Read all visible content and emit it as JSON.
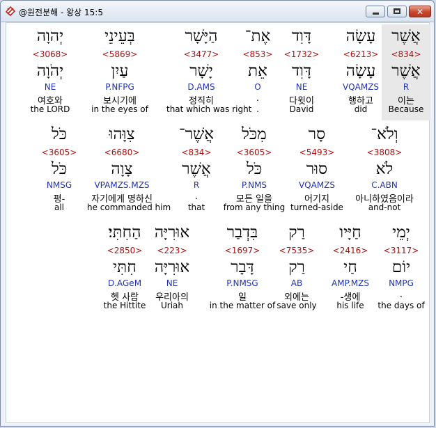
{
  "window": {
    "title": "@원전분해 - 왕상 15:5",
    "icon": "app-logo-icon",
    "controls": {
      "minimize": "minimize-icon",
      "maximize": "maximize-icon",
      "close": "close-icon"
    }
  },
  "rows": [
    {
      "words": [
        {
          "hebrew": "יְהוָה",
          "strong": "<3068>",
          "lemma": "יְהֹוָה",
          "morph": "NE",
          "korean": "여호와",
          "english": "the LORD"
        },
        {
          "hebrew": "בְּעֵינֵי",
          "strong": "<5869>",
          "lemma": "עַיִן",
          "morph": "P.NFPG",
          "korean": "보시기에",
          "english": "in the eyes of"
        },
        {
          "hebrew": "הַיָּשָׁר",
          "strong": "<3477>",
          "lemma": "יָשָׁר",
          "morph": "D.AMS",
          "korean": "정직히",
          "english": "that which was right"
        },
        {
          "hebrew": "אֶת־",
          "strong": "<853>",
          "lemma": "אֵת",
          "morph": "O",
          "korean": ".",
          "english": "."
        },
        {
          "hebrew": "דָּוִד",
          "strong": "<1732>",
          "lemma": "דָּוִד",
          "morph": "NE",
          "korean": "다윗이",
          "english": "David"
        },
        {
          "hebrew": "עָשָׂה",
          "strong": "<6213>",
          "lemma": "עָשָׂה",
          "morph": "VQAMZS",
          "korean": "행하고",
          "english": "did"
        },
        {
          "hebrew": "אֲשֶׁר",
          "strong": "<834>",
          "lemma": "אֲשֶׁר",
          "morph": "R",
          "korean": "이는",
          "english": "Because"
        }
      ]
    },
    {
      "words": [
        {
          "hebrew": "כֹּל",
          "strong": "<3605>",
          "lemma": "כֹּל",
          "morph": "NMSG",
          "korean": "평-",
          "english": "all"
        },
        {
          "hebrew": "צִוָּהוּ",
          "strong": "<6680>",
          "lemma": "צָוָה",
          "morph": "VPAMZS.MZS",
          "korean": "자기에게 명하신",
          "english": "he commanded him"
        },
        {
          "hebrew": "אֲשֶׁר־",
          "strong": "<834>",
          "lemma": "אֲשֶׁר",
          "morph": "R",
          "korean": ".",
          "english": "that"
        },
        {
          "hebrew": "מִכֹּל",
          "strong": "<3605>",
          "lemma": "כֹּל",
          "morph": "P.NMS",
          "korean": "모든 일을",
          "english": "from any thing"
        },
        {
          "hebrew": "סָר",
          "strong": "<5493>",
          "lemma": "סוּר",
          "morph": "VQAMZS",
          "korean": "어기지",
          "english": "turned-aside"
        },
        {
          "hebrew": "וְלֹא־",
          "strong": "<3808>",
          "lemma": "לֹא",
          "morph": "C.ABN",
          "korean": "아니하였음이라",
          "english": "and-not"
        }
      ]
    },
    {
      "words": [
        {
          "hebrew": "הַחִתִּי׃",
          "strong": "<2850>",
          "lemma": "חִתִּי",
          "morph": "D.AGeM",
          "korean": "헷 사람",
          "english": "the Hittite"
        },
        {
          "hebrew": "אוּרִיָּה",
          "strong": "<223>",
          "lemma": "אוּרִיָּה",
          "morph": "NE",
          "korean": "우리아의",
          "english": "Uriah"
        },
        {
          "hebrew": "בִּדְבַר",
          "strong": "<1697>",
          "lemma": "דָּבָר",
          "morph": "P.NMSG",
          "korean": "일",
          "english": "in the matter of"
        },
        {
          "hebrew": "רַק",
          "strong": "<7535>",
          "lemma": "רַק",
          "morph": "AB",
          "korean": "외에는",
          "english": "save only"
        },
        {
          "hebrew": "חַיָּיו",
          "strong": "<2416>",
          "lemma": "חַי",
          "morph": "AMP.MZS",
          "korean": "-생에",
          "english": "his life"
        },
        {
          "hebrew": "יְמֵי",
          "strong": "<3117>",
          "lemma": "יוֹם",
          "morph": "NMPG",
          "korean": ".",
          "english": "the days of"
        }
      ]
    }
  ]
}
